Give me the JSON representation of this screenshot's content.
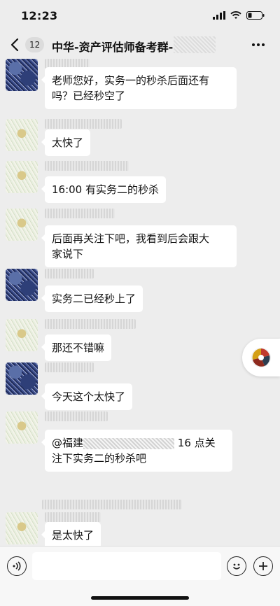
{
  "status": {
    "time": "12:23"
  },
  "nav": {
    "unread_count": "12",
    "title": "中华-资产评估师备考群-"
  },
  "messages": [
    {
      "avatar": "blue",
      "sender": "",
      "text": "老师您好，实务一的秒杀后面还有吗？已经秒空了",
      "lines": [
        "老师您好，实务一的秒杀后面还有",
        "吗？已经秒空了"
      ]
    },
    {
      "avatar": "light",
      "sender": "",
      "text": "太快了",
      "lines": [
        "太快了"
      ]
    },
    {
      "avatar": "light",
      "sender": "",
      "text": "16:00 有实务二的秒杀",
      "lines": [
        "16:00 有实务二的秒杀"
      ]
    },
    {
      "avatar": "light",
      "sender": "",
      "text": "后面再关注下吧，我看到后会跟大家说下",
      "lines": [
        "后面再关注下吧，我看到后会跟大",
        "家说下"
      ]
    },
    {
      "avatar": "blue",
      "sender": "",
      "text": "实务二已经秒上了",
      "lines": [
        "实务二已经秒上了"
      ]
    },
    {
      "avatar": "light",
      "sender": "",
      "text": "那还不错嘛",
      "lines": [
        "那还不错嘛"
      ]
    },
    {
      "avatar": "blue",
      "sender": "",
      "text": "今天这个太快了",
      "lines": [
        "今天这个太快了"
      ]
    },
    {
      "avatar": "light",
      "sender": "",
      "text_prefix": "@福建",
      "text_suffix": "16 点关",
      "line2": "注下实务二的秒杀吧"
    },
    {
      "avatar": "light",
      "sender": "",
      "text": "是太快了",
      "lines": [
        "是太快了"
      ]
    }
  ],
  "icons": {
    "back": "chevron-left-icon",
    "more": "more-dots-icon",
    "voice": "voice-icon",
    "emoji": "emoji-icon",
    "plus": "plus-icon",
    "float": "app-float-icon"
  }
}
